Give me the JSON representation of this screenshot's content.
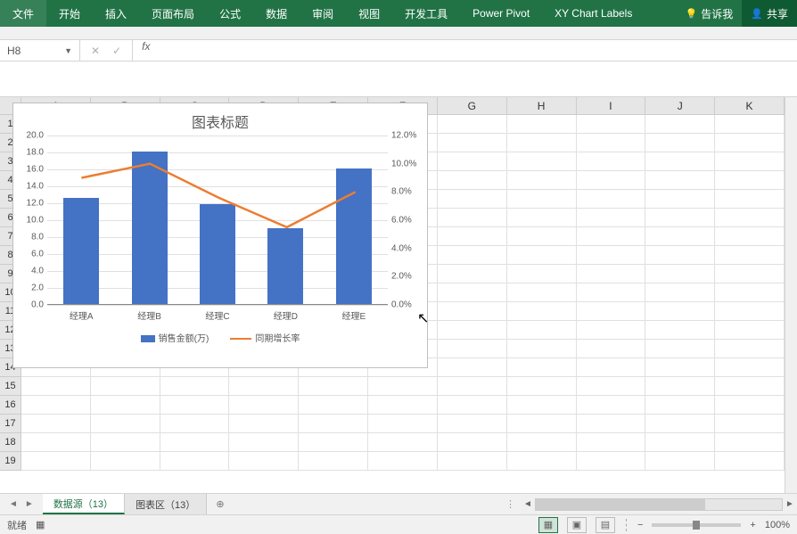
{
  "ribbon": {
    "tabs": [
      "文件",
      "开始",
      "插入",
      "页面布局",
      "公式",
      "数据",
      "审阅",
      "视图",
      "开发工具",
      "Power Pivot",
      "XY Chart Labels"
    ],
    "tell_me": "告诉我",
    "share": "共享"
  },
  "formula_bar": {
    "name_box": "H8",
    "cancel": "✕",
    "enter": "✓",
    "fx": "fx"
  },
  "columns": [
    "A",
    "B",
    "C",
    "D",
    "E",
    "F",
    "G",
    "H",
    "I",
    "J",
    "K"
  ],
  "rows": [
    "1",
    "2",
    "3",
    "4",
    "5",
    "6",
    "7",
    "8",
    "9",
    "10",
    "11",
    "12",
    "13",
    "14",
    "15",
    "16",
    "17",
    "18",
    "19"
  ],
  "sheets": {
    "nav_first": "|◄",
    "nav_prev": "◄",
    "nav_next": "►",
    "tab1": "数据源（13）",
    "tab2": "图表区（13）",
    "add": "⊕",
    "ellipsis": "⋮"
  },
  "scroll": {
    "left": "◄",
    "right": "►"
  },
  "status": {
    "ready": "就绪",
    "macro_icon": "▦",
    "zoom_out": "−",
    "zoom_in": "+",
    "zoom_label": "100%"
  },
  "chart_data": {
    "type": "bar_line_dual_axis",
    "title": "图表标题",
    "categories": [
      "经理A",
      "经理B",
      "经理C",
      "经理D",
      "经理E"
    ],
    "series": [
      {
        "name": "销售金额(万)",
        "kind": "bar",
        "axis": "left",
        "values": [
          12.5,
          18.0,
          11.8,
          9.0,
          16.0
        ],
        "color": "#4472c4"
      },
      {
        "name": "同期增长率",
        "kind": "line",
        "axis": "right",
        "values": [
          0.09,
          0.1,
          0.076,
          0.055,
          0.08
        ],
        "color": "#ed7d31"
      }
    ],
    "y_left": {
      "min": 0,
      "max": 20,
      "step": 2,
      "format": "0.0"
    },
    "y_right": {
      "min": 0,
      "max": 0.12,
      "step": 0.02,
      "format": "0.0%"
    },
    "legend_position": "bottom",
    "gridlines": true
  }
}
